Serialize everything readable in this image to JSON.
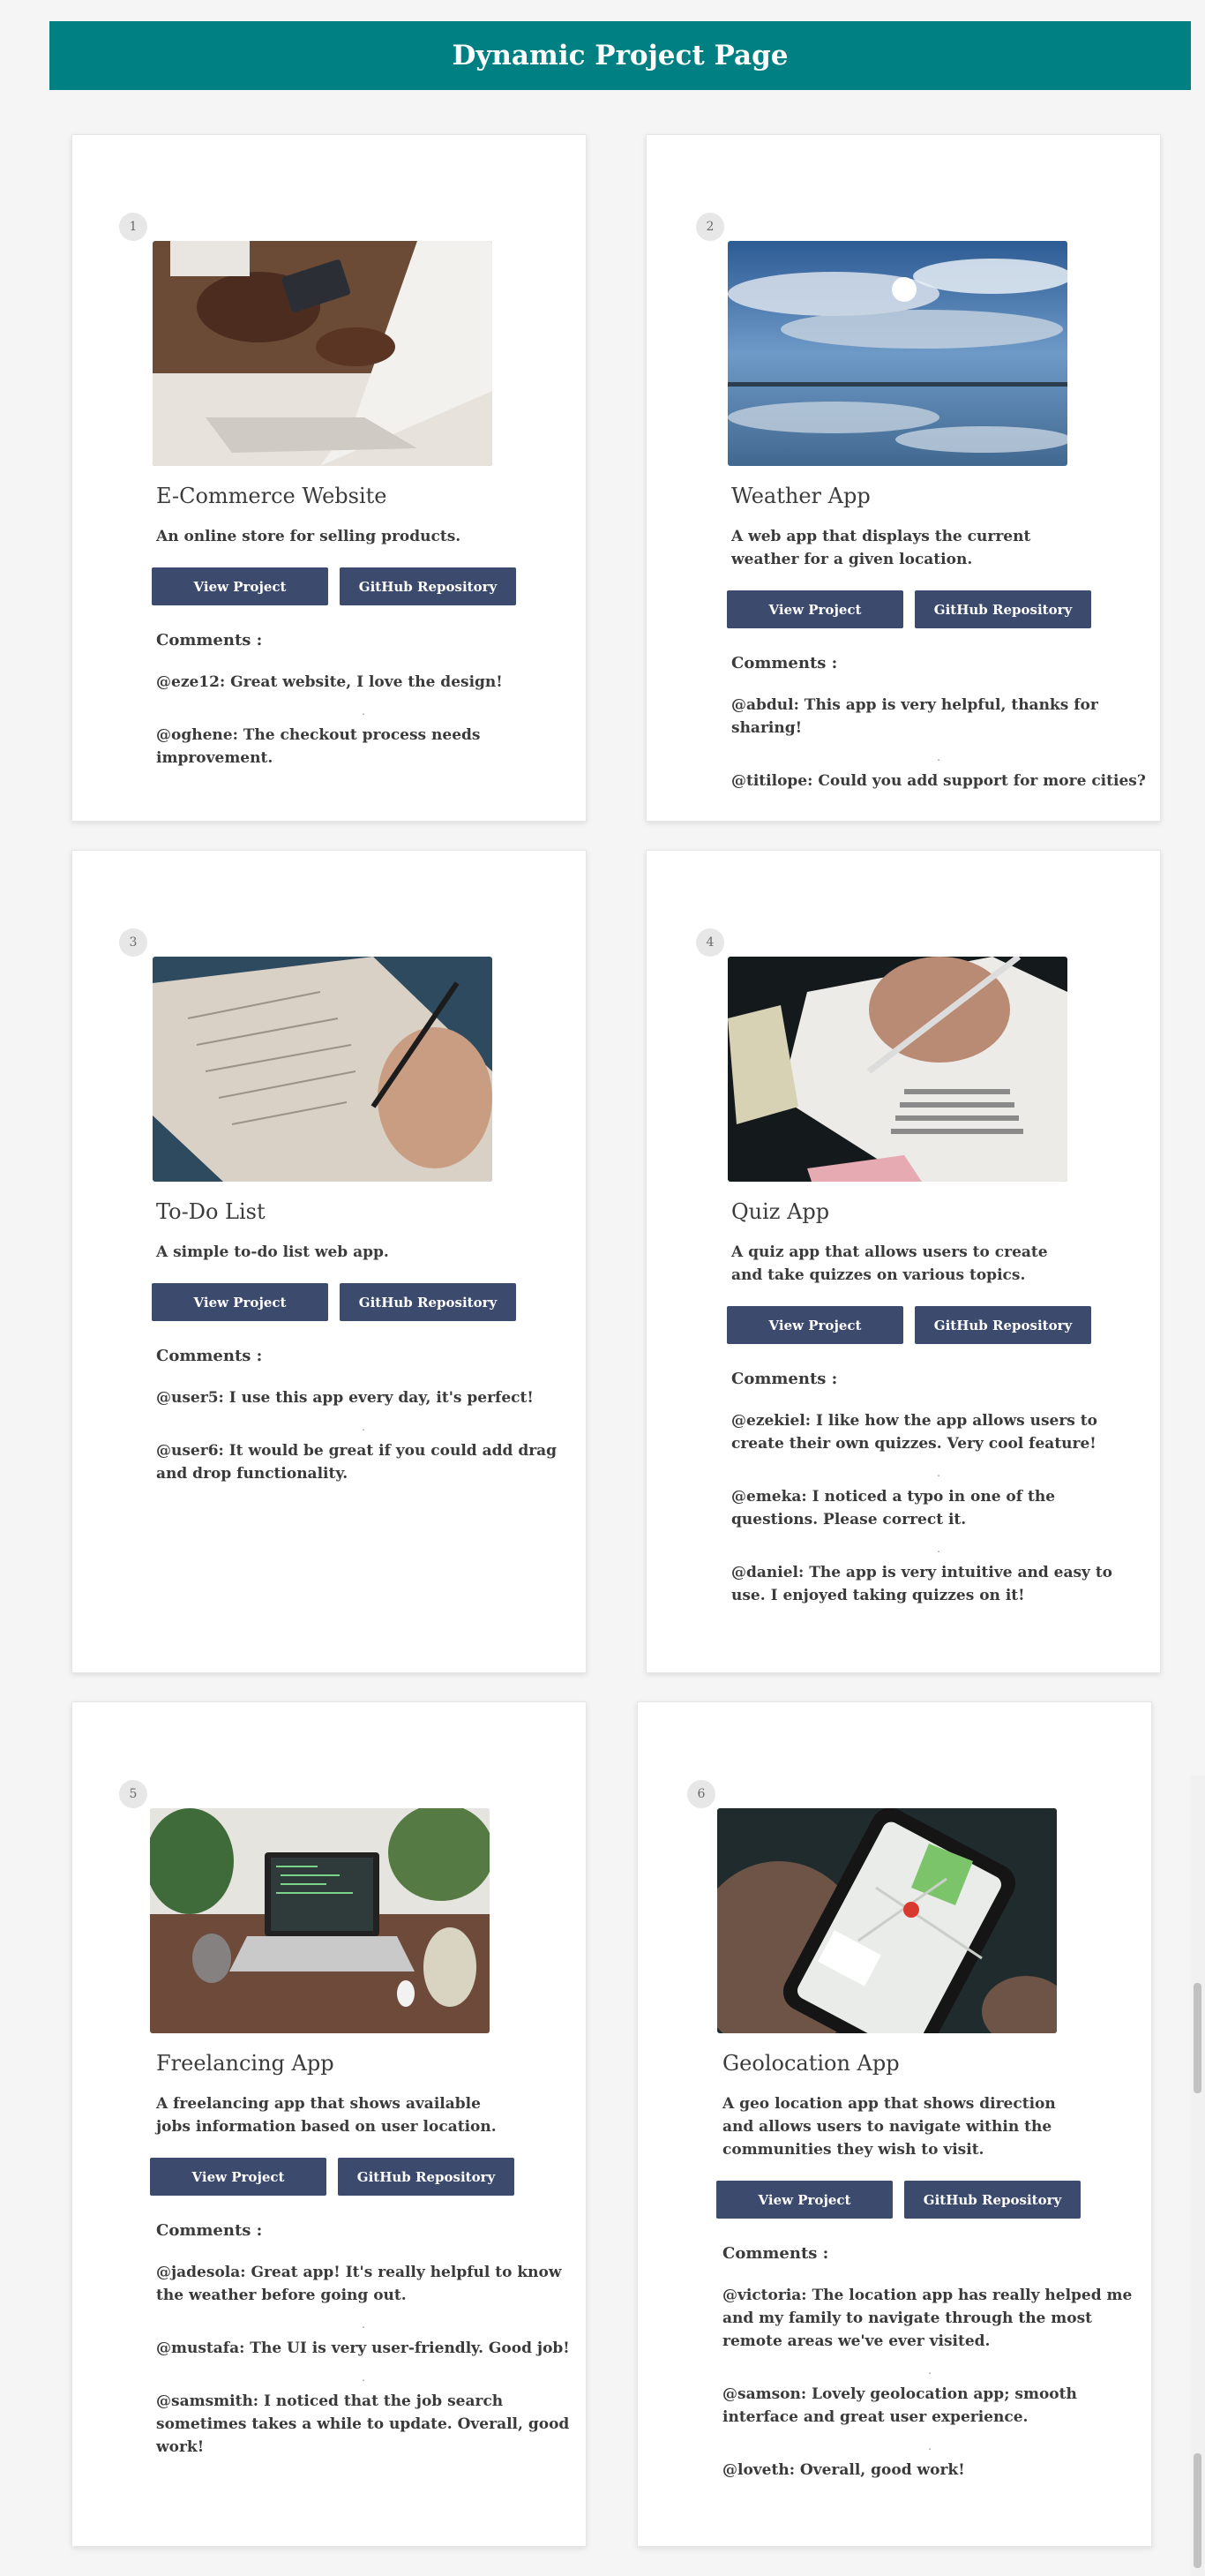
{
  "header": {
    "title": "Dynamic Project Page"
  },
  "labels": {
    "view_project": "View Project",
    "github": "GitHub Repository",
    "comments": "Comments :",
    "separator": "."
  },
  "projects": [
    {
      "number": "1",
      "title": "E-Commerce Website",
      "description": "An online store for selling products.",
      "image_icon": "laptop-credit-card-photo",
      "comments": [
        "@eze12: Great website, I love the design!",
        "@oghene: The checkout process needs improvement."
      ]
    },
    {
      "number": "2",
      "title": "Weather App",
      "description": "A web app that displays the current weather for a given location.",
      "image_icon": "sky-clouds-reflection-photo",
      "comments": [
        "@abdul: This app is very helpful, thanks for sharing!",
        "@titilope: Could you add support for more cities?"
      ]
    },
    {
      "number": "3",
      "title": "To-Do List",
      "description": "A simple to-do list web app.",
      "image_icon": "notebook-writing-photo",
      "comments": [
        "@user5: I use this app every day, it's perfect!",
        "@user6: It would be great if you could add drag and drop functionality."
      ]
    },
    {
      "number": "4",
      "title": "Quiz App",
      "description": "A quiz app that allows users to create and take quizzes on various topics.",
      "image_icon": "answer-sheet-pencil-photo",
      "comments": [
        "@ezekiel: I like how the app allows users to create their own quizzes. Very cool feature!",
        "@emeka: I noticed a typo in one of the questions. Please correct it.",
        "@daniel: The app is very intuitive and easy to use. I enjoyed taking quizzes on it!"
      ]
    },
    {
      "number": "5",
      "title": "Freelancing App",
      "description": "A freelancing app that shows available jobs information based on user location.",
      "image_icon": "laptop-desk-plants-photo",
      "comments": [
        "@jadesola: Great app! It's really helpful to know the weather before going out.",
        "@mustafa: The UI is very user-friendly. Good job!",
        "@samsmith: I noticed that the job search sometimes takes a while to update. Overall, good work!"
      ]
    },
    {
      "number": "6",
      "title": "Geolocation App",
      "description": "A geo location app that shows direction and allows users to navigate within the communities they wish to visit.",
      "image_icon": "phone-map-photo",
      "comments": [
        "@victoria: The location app has really helped me and my family to navigate through the most remote areas we've ever visited.",
        "@samson: Lovely geolocation app; smooth interface and great user experience.",
        "@loveth: Overall, good work!"
      ]
    }
  ],
  "colors": {
    "header_bg": "#008083",
    "button_bg": "#3c4a6e",
    "page_bg": "#f5f5f5"
  }
}
